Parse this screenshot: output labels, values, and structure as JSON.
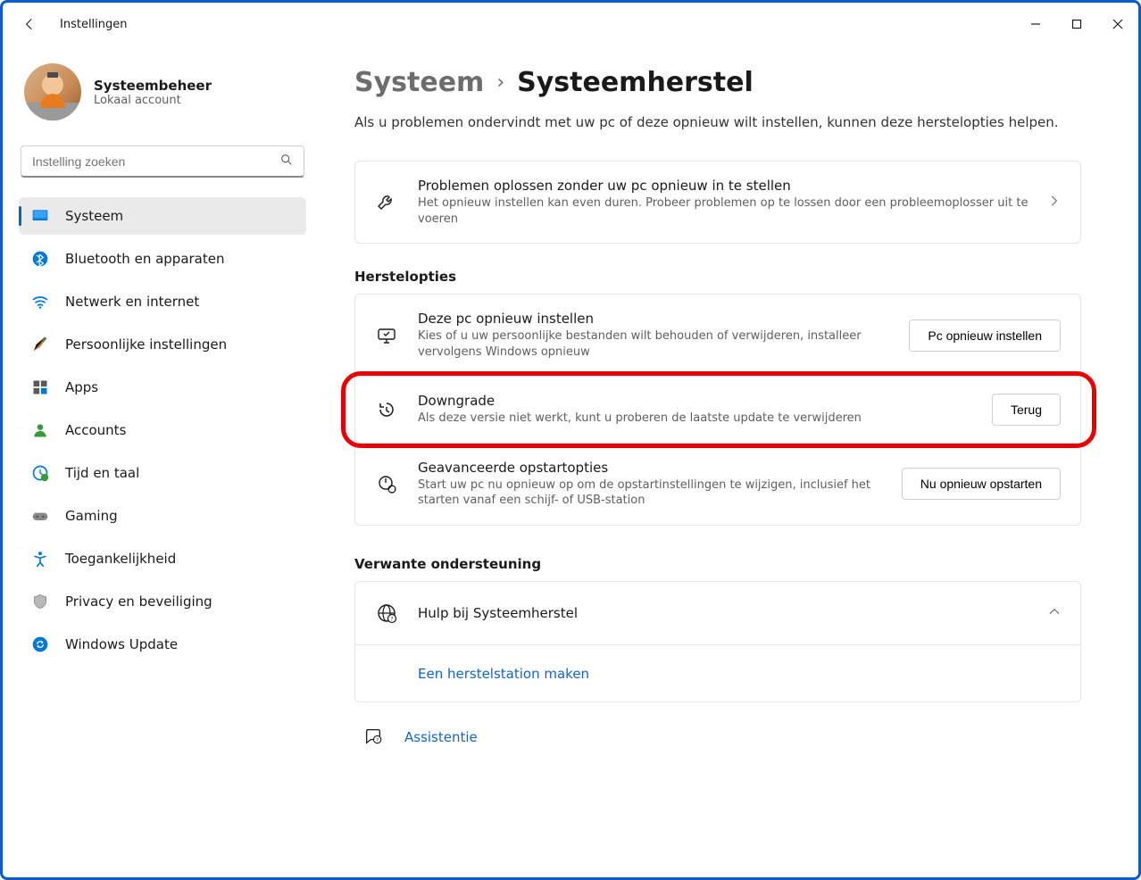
{
  "window": {
    "title": "Instellingen"
  },
  "profile": {
    "name": "Systeembeheer",
    "subtitle": "Lokaal account"
  },
  "search": {
    "placeholder": "Instelling zoeken"
  },
  "nav": {
    "system": "Systeem",
    "bluetooth": "Bluetooth en apparaten",
    "network": "Netwerk en internet",
    "personal": "Persoonlijke instellingen",
    "apps": "Apps",
    "accounts": "Accounts",
    "time": "Tijd en taal",
    "gaming": "Gaming",
    "access": "Toegankelijkheid",
    "privacy": "Privacy en beveiliging",
    "update": "Windows Update"
  },
  "breadcrumb": {
    "root": "Systeem",
    "current": "Systeemherstel"
  },
  "intro": "Als u problemen ondervindt met uw pc of deze opnieuw wilt instellen, kunnen deze herstelopties helpen.",
  "troubleshoot": {
    "title": "Problemen oplossen zonder uw pc opnieuw in te stellen",
    "desc": "Het opnieuw instellen kan even duren. Probeer problemen op te lossen door een probleemoplosser uit te voeren"
  },
  "sections": {
    "recovery": "Herstelopties",
    "support": "Verwante ondersteuning"
  },
  "recovery": {
    "reset": {
      "title": "Deze pc opnieuw instellen",
      "desc": "Kies of u uw persoonlijke bestanden wilt behouden of verwijderen, installeer vervolgens Windows opnieuw",
      "button": "Pc opnieuw instellen"
    },
    "downgrade": {
      "title": "Downgrade",
      "desc": "Als deze versie niet werkt, kunt u proberen de laatste update te verwijderen",
      "button": "Terug"
    },
    "advanced": {
      "title": "Geavanceerde opstartopties",
      "desc": "Start uw pc nu opnieuw op om de opstartinstellingen te wijzigen, inclusief het starten vanaf een schijf- of USB-station",
      "button": "Nu opnieuw opstarten"
    }
  },
  "support": {
    "title": "Hulp bij Systeemherstel",
    "link": "Een herstelstation maken"
  },
  "assist": {
    "label": "Assistentie"
  }
}
